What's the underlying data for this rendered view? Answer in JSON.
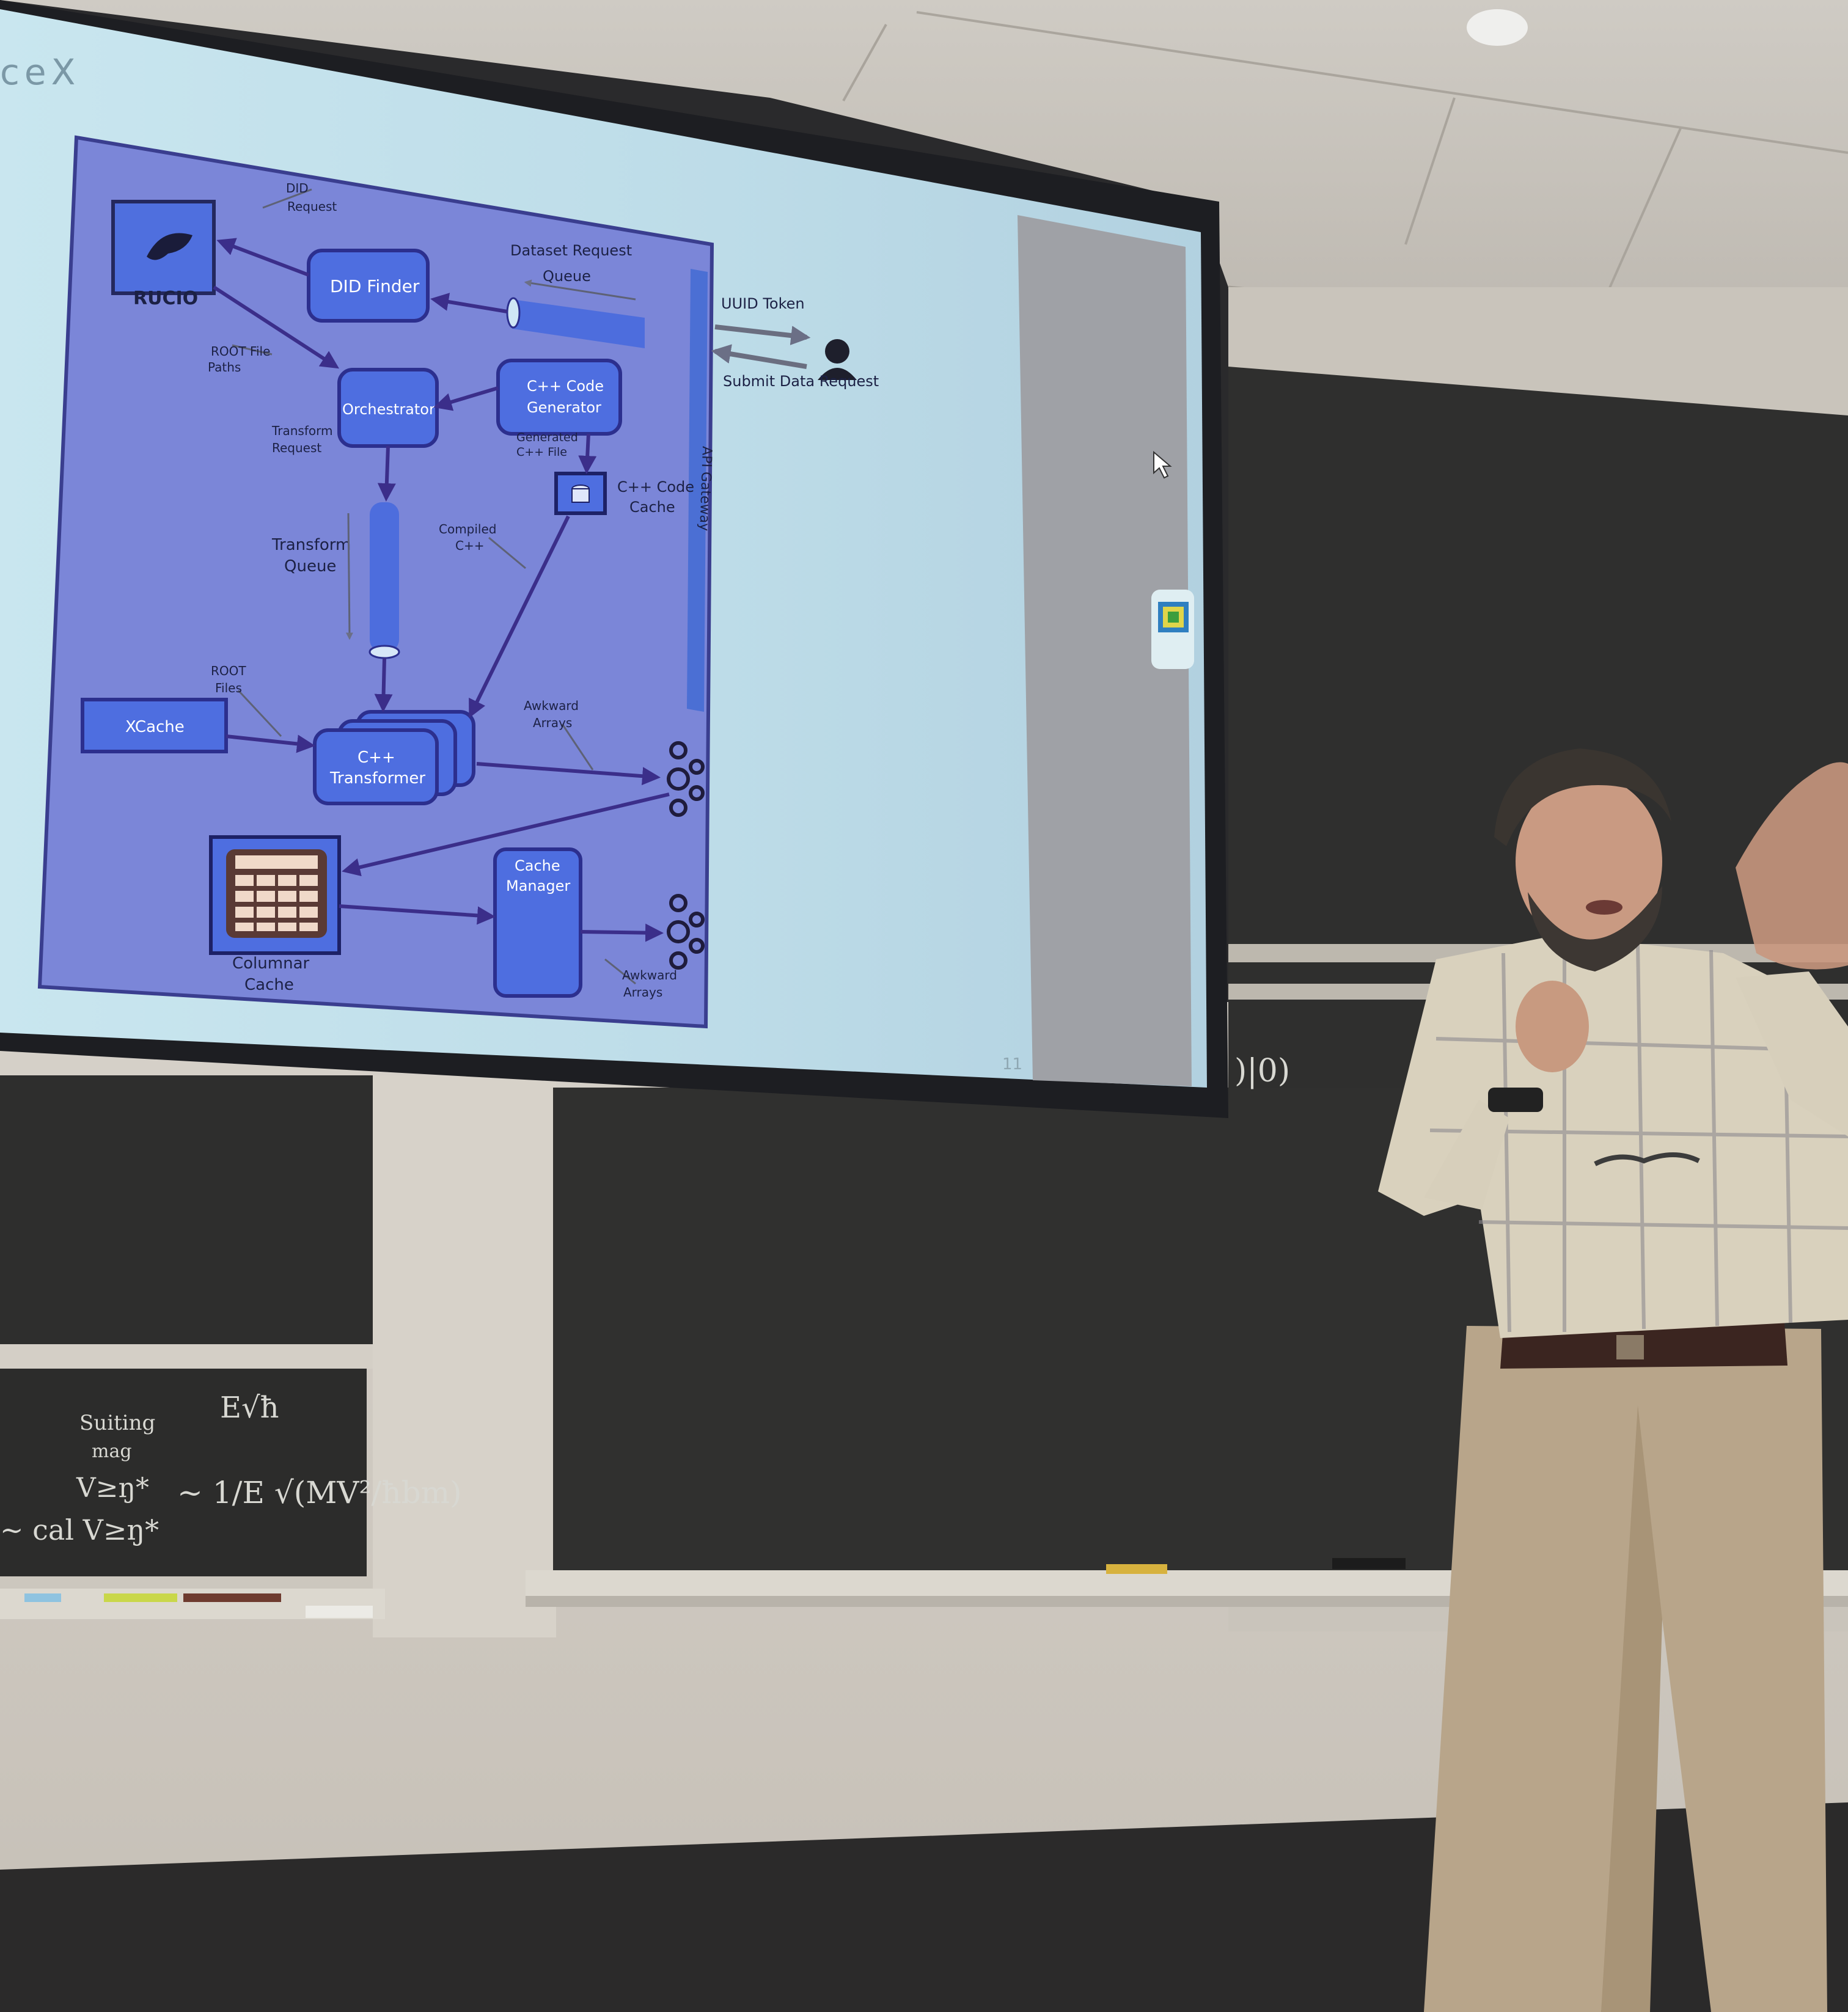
{
  "slide": {
    "title_fragment": "ceX",
    "page_number": "11",
    "gateway_label": "API Gateway",
    "user_link": {
      "token_label": "UUID Token",
      "request_label": "Submit Data Request"
    },
    "nodes": {
      "rucio": "RUCIO",
      "did_finder": "DID Finder",
      "orchestrator": "Orchestrator",
      "code_generator": [
        "C++ Code",
        "Generator"
      ],
      "code_cache": [
        "C++ Code",
        "Cache"
      ],
      "transform_queue": [
        "Transform",
        "Queue"
      ],
      "xcache": "XCache",
      "transformer": [
        "C++",
        "Transformer"
      ],
      "columnar_cache": [
        "Columnar",
        "Cache"
      ],
      "cache_manager": [
        "Cache",
        "Manager"
      ],
      "dataset_queue": [
        "Dataset Request",
        "Queue"
      ]
    },
    "edge_labels": {
      "did_request": [
        "DID",
        "Request"
      ],
      "root_file_paths": [
        "ROOT File",
        "Paths"
      ],
      "transform_request": [
        "Transform",
        "Request"
      ],
      "generated_file": [
        "Generated",
        "C++ File"
      ],
      "compiled": [
        "Compiled",
        "C++"
      ],
      "root_files": [
        "ROOT",
        "Files"
      ],
      "awkward_arrays_1": [
        "Awkward",
        "Arrays"
      ],
      "awkward_arrays_2": [
        "Awkward",
        "Arrays"
      ]
    }
  },
  "chalkboard": {
    "notes": [
      "E√ħ",
      "Suiting",
      "mag",
      "~ 1/E √(MV²/ħbm)",
      "~ cal V≥ŋ*",
      "V≥ŋ*",
      ")|0)"
    ]
  },
  "colors": {
    "slide_bg": "#b9dbe6",
    "diagram_bg": "#7a84d8",
    "node_fill": "#4e6ee0",
    "node_stroke": "#2c2f8e",
    "blackboard": "#2f2f2e"
  }
}
